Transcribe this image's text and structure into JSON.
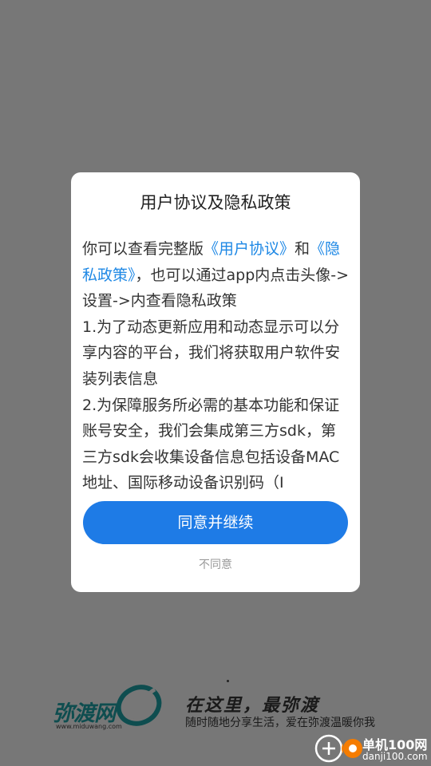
{
  "dialog": {
    "title": "用户协议及隐私政策",
    "intro_prefix": "你可以查看完整版",
    "user_agreement_link": "《用户协议》",
    "and": "和",
    "privacy_policy_link": "《隐私政策》",
    "intro_suffix": "，也可以通过app内点击头像->设置->内查看隐私政策",
    "paragraphs": [
      "1.为了动态更新应用和动态显示可以分享内容的平台，我们将获取用户软件安装列表信息",
      "2.为保障服务所必需的基本功能和保证账号安全，我们会集成第三方sdk，第三方sdk会收集设备信息包括设备MAC地址、国际移动设备识别码（I"
    ],
    "agree_button": "同意并继续",
    "disagree_button": "不同意"
  },
  "splash": {
    "logo_text": "弥渡网",
    "logo_url": "www.miduwang.com",
    "slogan": "在这里，最弥渡",
    "sub_slogan": "随时随地分享生活，爱在弥渡温暖你我"
  },
  "watermark": {
    "title": "单机100网",
    "url": "danji100.com"
  },
  "colors": {
    "backdrop": "#777777",
    "accent": "#1e7be6",
    "link": "#1e88e5"
  }
}
